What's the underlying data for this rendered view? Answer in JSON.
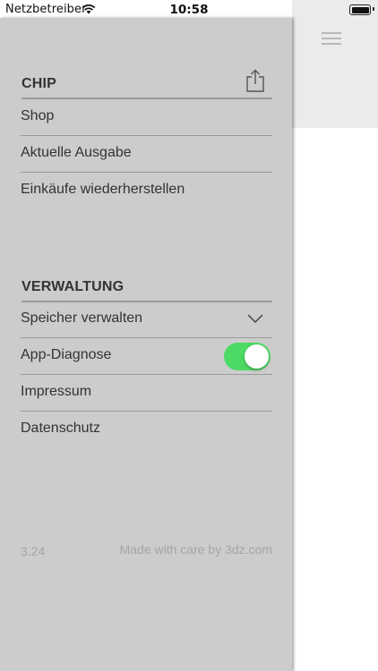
{
  "status_bar": {
    "carrier": "Netzbetreiber",
    "time": "10:58"
  },
  "menu": {
    "sections": [
      {
        "title": "CHIP",
        "items": [
          {
            "label": "Shop"
          },
          {
            "label": "Aktuelle Ausgabe"
          },
          {
            "label": "Einkäufe wiederherstellen"
          }
        ]
      },
      {
        "title": "VERWALTUNG",
        "items": [
          {
            "label": "Speicher verwalten",
            "control": "chevron-down-icon"
          },
          {
            "label": "App-Diagnose",
            "control": "toggle",
            "toggle_on": true
          },
          {
            "label": "Impressum"
          },
          {
            "label": "Datenschutz"
          }
        ]
      }
    ],
    "toggle_color": "#4cd964",
    "background": "#cccccc"
  },
  "footer": {
    "version": "3.24",
    "credit": "Made with care by 3dz.com"
  }
}
